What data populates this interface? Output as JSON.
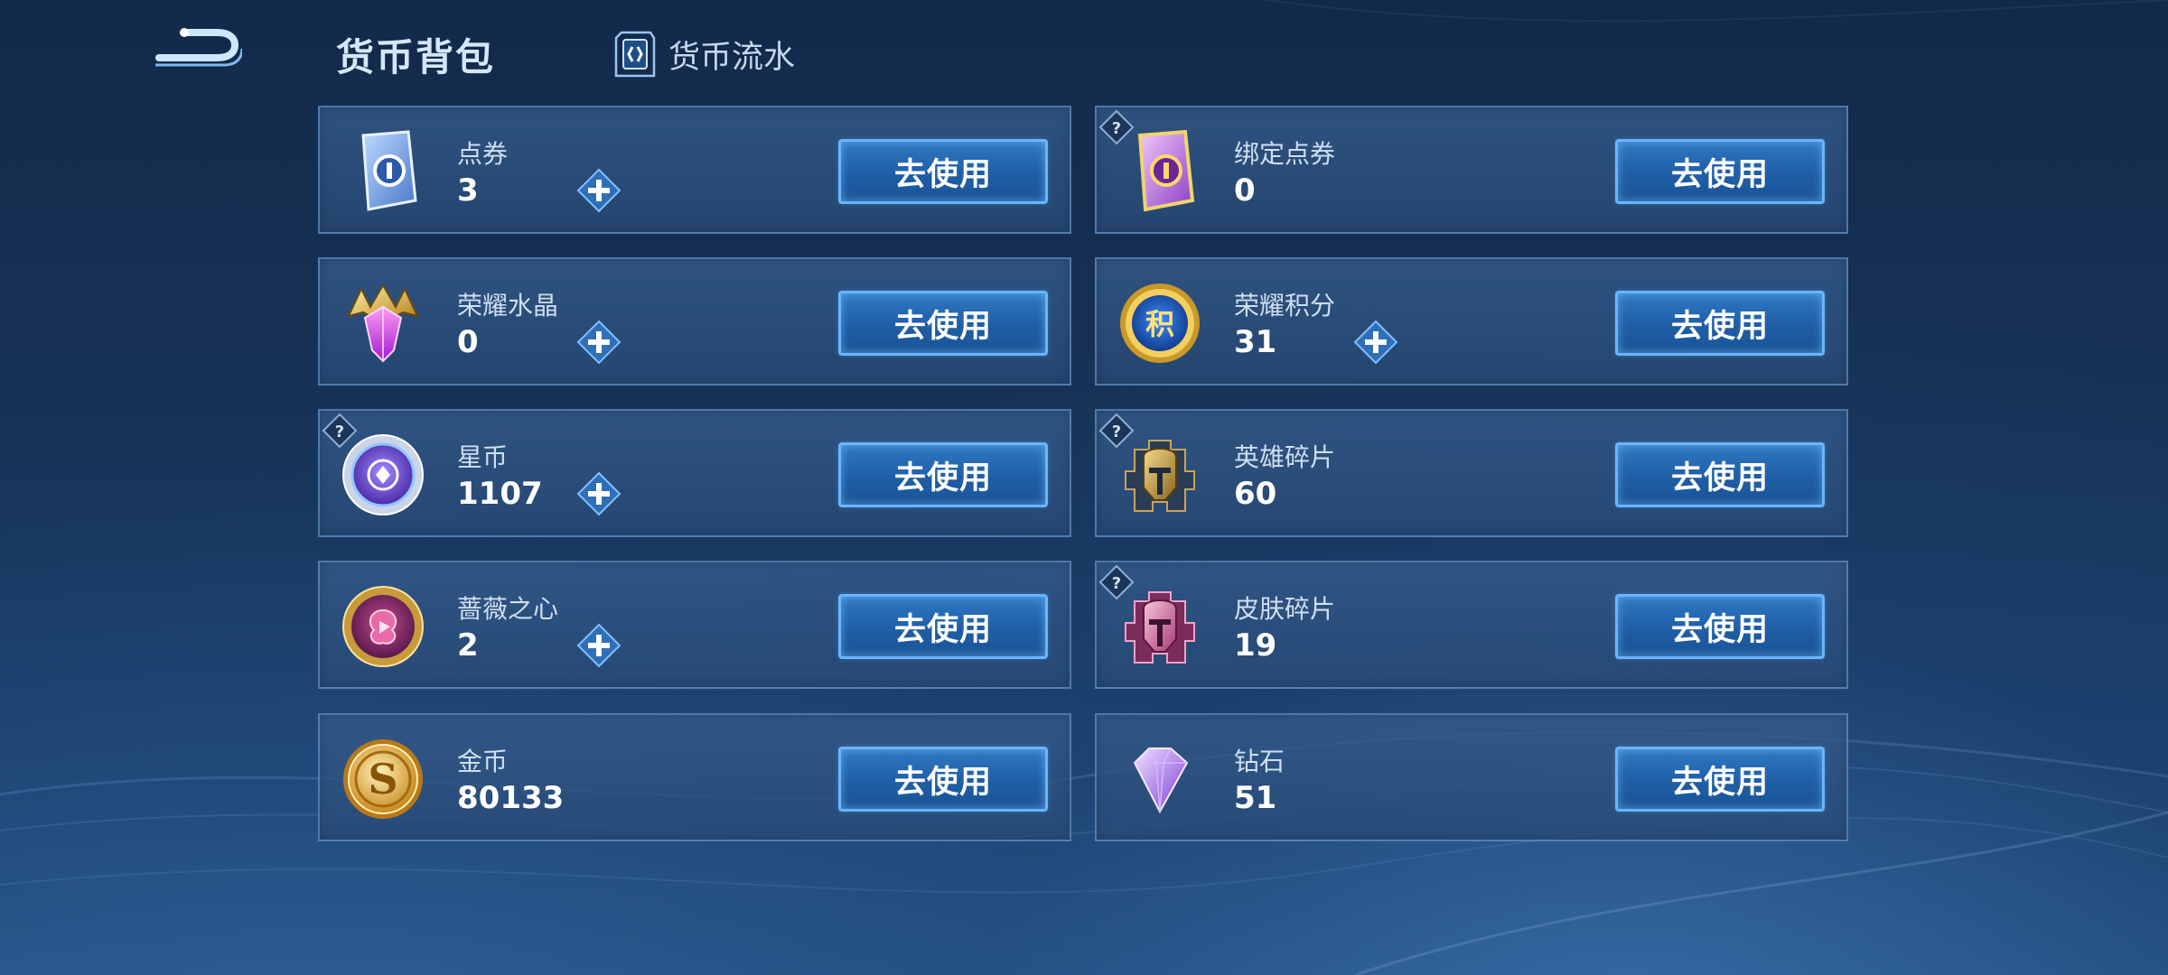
{
  "header": {
    "title": "货币背包",
    "history_tab_label": "货币流水"
  },
  "colors": {
    "accent_blue": "#68b6ff",
    "button_fill": "#1f5ea6",
    "card_bg": "#2f5a8a"
  },
  "items": [
    {
      "name": "点券",
      "value": "3",
      "icon": "coupon-ticket-icon",
      "has_plus": true,
      "has_help": false,
      "button_label": "去使用"
    },
    {
      "name": "绑定点券",
      "value": "0",
      "icon": "bound-coupon-ticket-icon",
      "has_plus": false,
      "has_help": true,
      "button_label": "去使用"
    },
    {
      "name": "荣耀水晶",
      "value": "0",
      "icon": "glory-crystal-icon",
      "has_plus": true,
      "has_help": false,
      "button_label": "去使用"
    },
    {
      "name": "荣耀积分",
      "value": "31",
      "icon": "glory-points-icon",
      "has_plus": true,
      "has_help": false,
      "button_label": "去使用"
    },
    {
      "name": "星币",
      "value": "1107",
      "icon": "star-coin-icon",
      "has_plus": true,
      "has_help": true,
      "button_label": "去使用"
    },
    {
      "name": "英雄碎片",
      "value": "60",
      "icon": "hero-fragment-icon",
      "has_plus": false,
      "has_help": true,
      "button_label": "去使用"
    },
    {
      "name": "蔷薇之心",
      "value": "2",
      "icon": "rose-heart-icon",
      "has_plus": true,
      "has_help": false,
      "button_label": "去使用"
    },
    {
      "name": "皮肤碎片",
      "value": "19",
      "icon": "skin-fragment-icon",
      "has_plus": false,
      "has_help": true,
      "button_label": "去使用"
    },
    {
      "name": "金币",
      "value": "80133",
      "icon": "gold-coin-icon",
      "has_plus": false,
      "has_help": false,
      "button_label": "去使用"
    },
    {
      "name": "钻石",
      "value": "51",
      "icon": "diamond-icon",
      "has_plus": false,
      "has_help": false,
      "button_label": "去使用"
    }
  ]
}
